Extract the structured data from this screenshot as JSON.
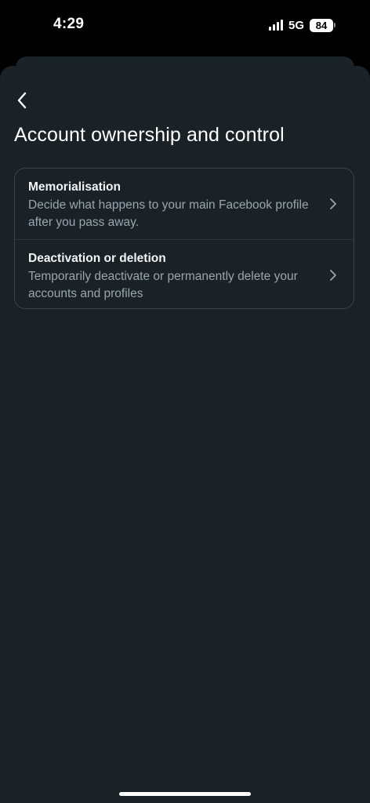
{
  "status_bar": {
    "time": "4:29",
    "network": "5G",
    "battery": "84",
    "icons": [
      "signal-icon",
      "battery-icon"
    ]
  },
  "header": {
    "back_icon": "chevron-left-icon",
    "title": "Account ownership and control"
  },
  "options": [
    {
      "title": "Memorialisation",
      "description": "Decide what happens to your main Facebook profile after you pass away.",
      "icon": "chevron-right-icon"
    },
    {
      "title": "Deactivation or deletion",
      "description": "Temporarily deactivate or permanently delete your accounts and profiles",
      "icon": "chevron-right-icon"
    }
  ],
  "colors": {
    "sheet_background": "#1a2127",
    "title_text": "#ffffff",
    "secondary_text": "#9aa6ad",
    "card_border": "#3a454d"
  }
}
